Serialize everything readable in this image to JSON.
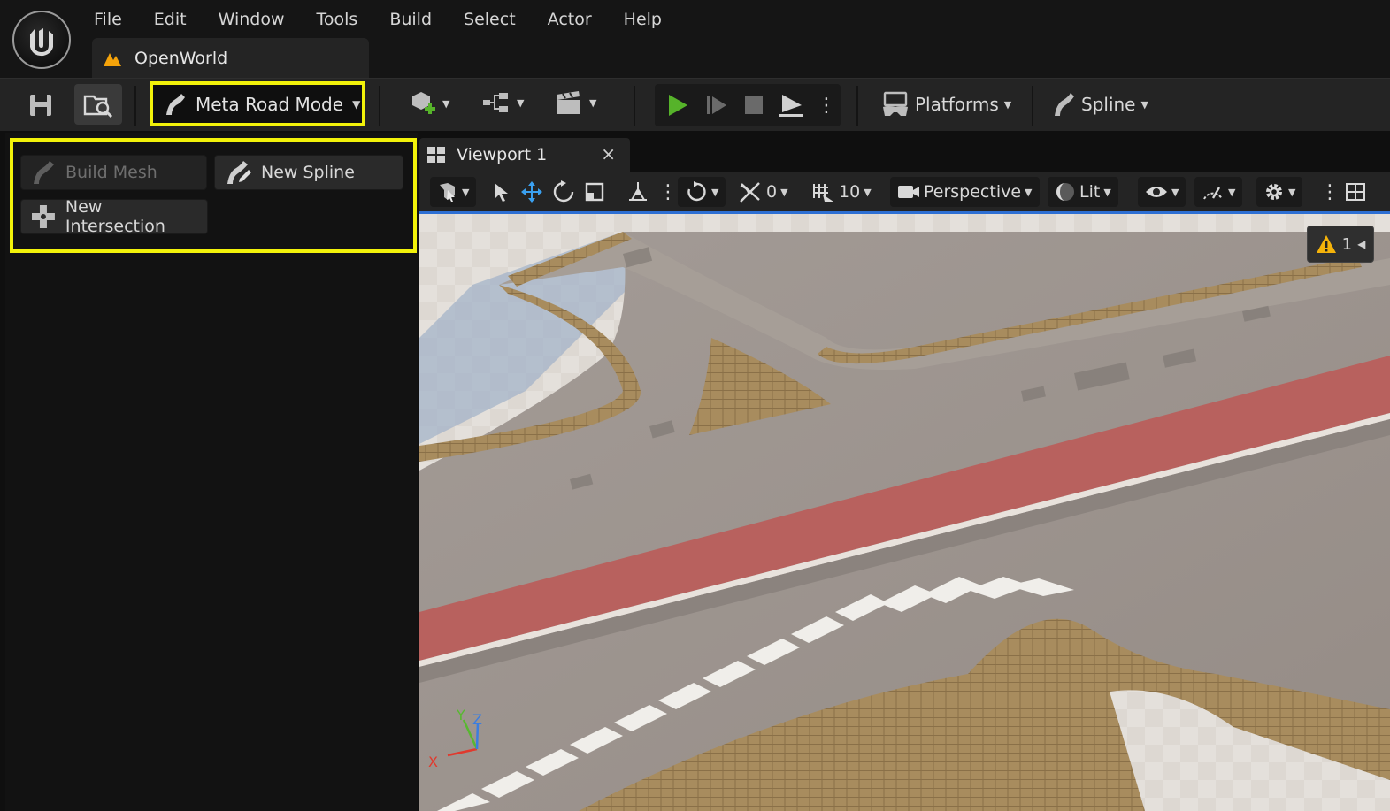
{
  "menu": [
    "File",
    "Edit",
    "Window",
    "Tools",
    "Build",
    "Select",
    "Actor",
    "Help"
  ],
  "doc_tab": {
    "title": "OpenWorld"
  },
  "toolbar": {
    "mode_label": "Meta Road Mode",
    "platforms_label": "Platforms",
    "spline_label": "Spline"
  },
  "tools": {
    "build_mesh": "Build Mesh",
    "new_spline": "New Spline",
    "new_intersection": "New Intersection"
  },
  "viewport": {
    "tab_label": "Viewport 1",
    "close_glyph": "×",
    "snap_angle": "0",
    "grid_size": "10",
    "view_mode": "Perspective",
    "lighting": "Lit",
    "warning_count": "1",
    "axis_x": "X",
    "axis_y": "Y",
    "axis_z": "Z"
  },
  "colors": {
    "highlight": "#f2f20a",
    "play_green": "#56b32a",
    "accent_blue": "#2d6fd3",
    "warning": "#f5b30a"
  }
}
